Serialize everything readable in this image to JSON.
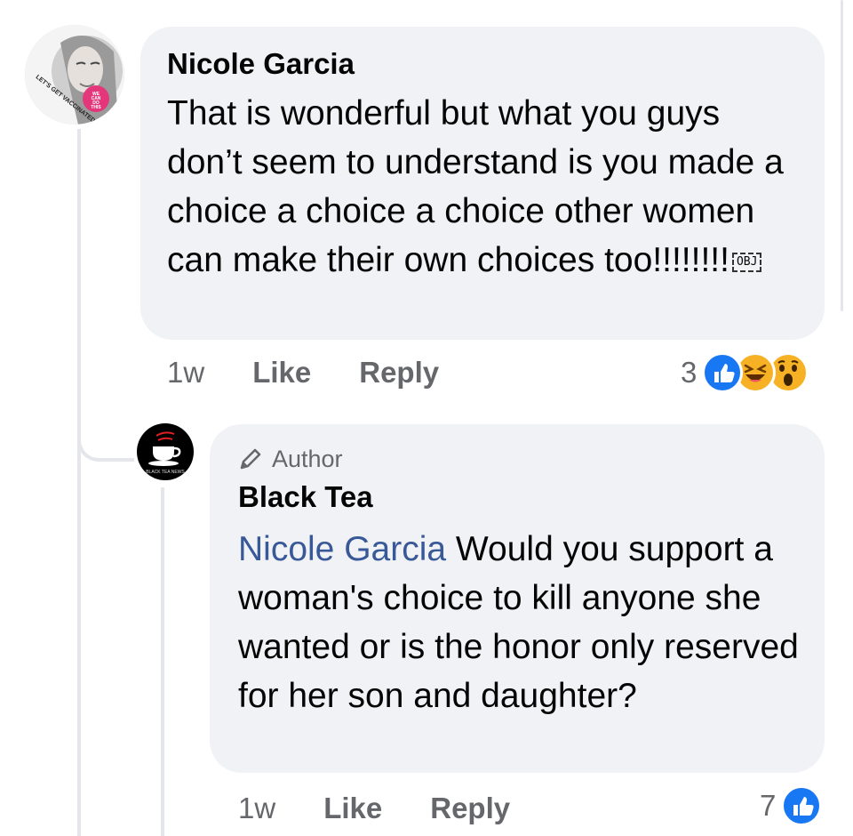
{
  "comment1": {
    "author": "Nicole Garcia",
    "text": "That is wonderful but what you guys don’t seem to understand is you made a choice a choice a choice other women can make their own choices too!!!!!!!!",
    "obj_glyph": "OBJ",
    "avatar_badge": "LET'S GET VACCINATED",
    "avatar_sticker": "WE CAN DO THIS",
    "time": "1w",
    "like_label": "Like",
    "reply_label": "Reply",
    "reaction_count": "3",
    "reactions": [
      "like-icon",
      "laugh-icon",
      "wow-icon"
    ]
  },
  "comment2": {
    "badge": "Author",
    "author": "Black Tea",
    "mention": "Nicole Garcia",
    "text": " Would you support a woman's choice to kill anyone she wanted or is the honor only reserved for her son and daughter?",
    "time": "1w",
    "like_label": "Like",
    "reply_label": "Reply",
    "reaction_count": "7",
    "reactions": [
      "like-icon"
    ]
  },
  "colors": {
    "bubble": "#f0f2f5",
    "meta": "#65676b",
    "mention": "#385898",
    "like_blue": "#1877f2",
    "reaction_yellow": "#f7b125"
  }
}
